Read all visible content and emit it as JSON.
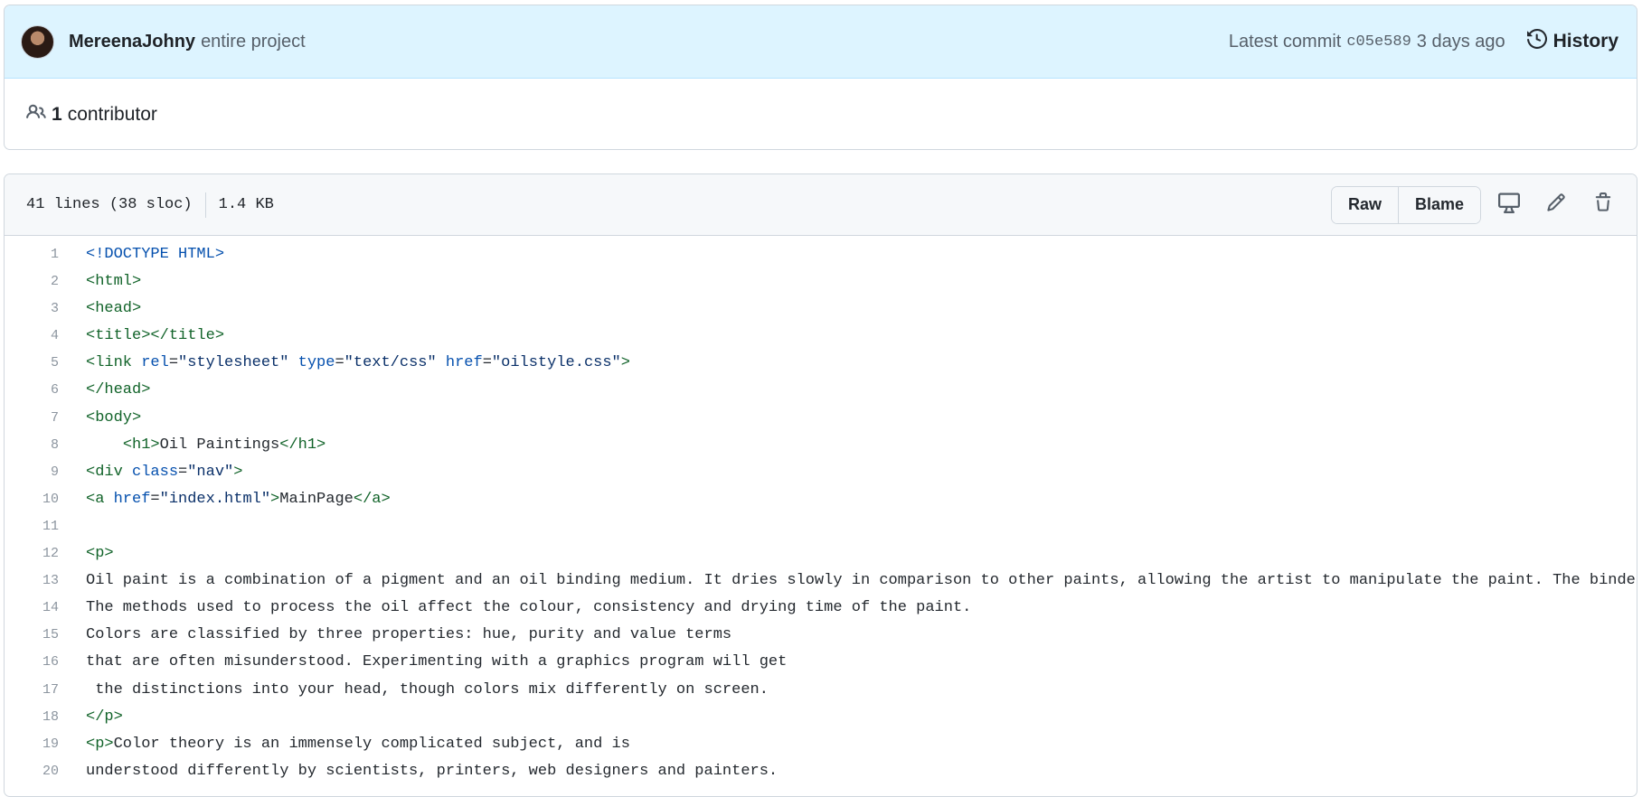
{
  "commit": {
    "author": "MereenaJohny",
    "message": "entire project",
    "latest_label": "Latest commit",
    "sha": "c05e589",
    "age": "3 days ago",
    "history_label": "History"
  },
  "contributors": {
    "count": "1",
    "label": "contributor"
  },
  "file": {
    "lines_info": "41 lines (38 sloc)",
    "size": "1.4 KB",
    "raw_label": "Raw",
    "blame_label": "Blame"
  },
  "icons": {
    "history": "history-icon",
    "contributors": "people-icon",
    "display": "desktop-icon",
    "edit": "pencil-icon",
    "delete": "trash-icon"
  },
  "colors": {
    "header_bg": "#ddf4ff",
    "tag": "#116329",
    "attr": "#0550ae",
    "string": "#0a3069",
    "line_number": "#8c959f"
  },
  "code_lines": [
    {
      "n": "1",
      "t": [
        {
          "k": "doc",
          "v": "<!DOCTYPE HTML>"
        }
      ]
    },
    {
      "n": "2",
      "t": [
        {
          "k": "tag",
          "v": "<html>"
        }
      ]
    },
    {
      "n": "3",
      "t": [
        {
          "k": "tag",
          "v": "<head>"
        }
      ]
    },
    {
      "n": "4",
      "t": [
        {
          "k": "tag",
          "v": "<title></title>"
        }
      ]
    },
    {
      "n": "5",
      "t": [
        {
          "k": "tag",
          "v": "<link "
        },
        {
          "k": "attr",
          "v": "rel"
        },
        {
          "k": "txt",
          "v": "="
        },
        {
          "k": "str",
          "v": "\"stylesheet\""
        },
        {
          "k": "txt",
          "v": " "
        },
        {
          "k": "attr",
          "v": "type"
        },
        {
          "k": "txt",
          "v": "="
        },
        {
          "k": "str",
          "v": "\"text/css\""
        },
        {
          "k": "txt",
          "v": " "
        },
        {
          "k": "attr",
          "v": "href"
        },
        {
          "k": "txt",
          "v": "="
        },
        {
          "k": "str",
          "v": "\"oilstyle.css\""
        },
        {
          "k": "tag",
          "v": ">"
        }
      ]
    },
    {
      "n": "6",
      "t": [
        {
          "k": "tag",
          "v": "</head>"
        }
      ]
    },
    {
      "n": "7",
      "t": [
        {
          "k": "tag",
          "v": "<body>"
        }
      ]
    },
    {
      "n": "8",
      "t": [
        {
          "k": "txt",
          "v": "    "
        },
        {
          "k": "tag",
          "v": "<h1>"
        },
        {
          "k": "txt",
          "v": "Oil Paintings"
        },
        {
          "k": "tag",
          "v": "</h1>"
        }
      ]
    },
    {
      "n": "9",
      "t": [
        {
          "k": "tag",
          "v": "<div "
        },
        {
          "k": "attr",
          "v": "class"
        },
        {
          "k": "txt",
          "v": "="
        },
        {
          "k": "str",
          "v": "\"nav\""
        },
        {
          "k": "tag",
          "v": ">"
        }
      ]
    },
    {
      "n": "10",
      "t": [
        {
          "k": "tag",
          "v": "<a "
        },
        {
          "k": "attr",
          "v": "href"
        },
        {
          "k": "txt",
          "v": "="
        },
        {
          "k": "str",
          "v": "\"index.html\""
        },
        {
          "k": "tag",
          "v": ">"
        },
        {
          "k": "txt",
          "v": "MainPage"
        },
        {
          "k": "tag",
          "v": "</a>"
        }
      ]
    },
    {
      "n": "11",
      "t": [
        {
          "k": "txt",
          "v": ""
        }
      ]
    },
    {
      "n": "12",
      "t": [
        {
          "k": "tag",
          "v": "<p>"
        }
      ]
    },
    {
      "n": "13",
      "t": [
        {
          "k": "txt",
          "v": "Oil paint is a combination of a pigment and an oil binding medium. It dries slowly in comparison to other paints, allowing the artist to manipulate the paint. The binder is"
        }
      ]
    },
    {
      "n": "14",
      "t": [
        {
          "k": "txt",
          "v": "The methods used to process the oil affect the colour, consistency and drying time of the paint."
        }
      ]
    },
    {
      "n": "15",
      "t": [
        {
          "k": "txt",
          "v": "Colors are classified by three properties: hue, purity and value terms"
        }
      ]
    },
    {
      "n": "16",
      "t": [
        {
          "k": "txt",
          "v": "that are often misunderstood. Experimenting with a graphics program will get"
        }
      ]
    },
    {
      "n": "17",
      "t": [
        {
          "k": "txt",
          "v": " the distinctions into your head, though colors mix differently on screen."
        }
      ]
    },
    {
      "n": "18",
      "t": [
        {
          "k": "tag",
          "v": "</p>"
        }
      ]
    },
    {
      "n": "19",
      "t": [
        {
          "k": "tag",
          "v": "<p>"
        },
        {
          "k": "txt",
          "v": "Color theory is an immensely complicated subject, and is"
        }
      ]
    },
    {
      "n": "20",
      "t": [
        {
          "k": "txt",
          "v": "understood differently by scientists, printers, web designers and painters."
        }
      ]
    }
  ]
}
